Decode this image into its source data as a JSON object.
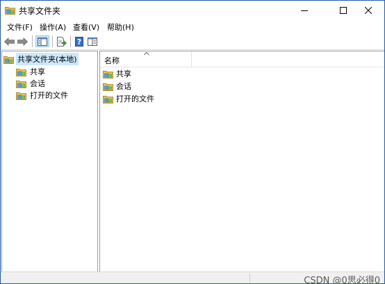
{
  "window": {
    "title": "共享文件夹"
  },
  "menu": [
    {
      "label": "文件(F)"
    },
    {
      "label": "操作(A)"
    },
    {
      "label": "查看(V)"
    },
    {
      "label": "帮助(H)"
    }
  ],
  "toolbar": {
    "icons": [
      "back-arrow-icon",
      "forward-arrow-icon",
      "show-hide-tree-icon",
      "export-list-icon",
      "help-icon",
      "properties-view-icon"
    ]
  },
  "tree": {
    "root": "共享文件夹(本地)",
    "items": [
      {
        "label": "共享"
      },
      {
        "label": "会话"
      },
      {
        "label": "打开的文件"
      }
    ]
  },
  "list": {
    "column_header": "名称",
    "items": [
      {
        "label": "共享"
      },
      {
        "label": "会话"
      },
      {
        "label": "打开的文件"
      }
    ]
  },
  "watermark": "CSDN @0思必得0",
  "colors": {
    "accent": "#1e5aa8",
    "selection": "#cce8ff",
    "folder": "#e8c45a"
  }
}
